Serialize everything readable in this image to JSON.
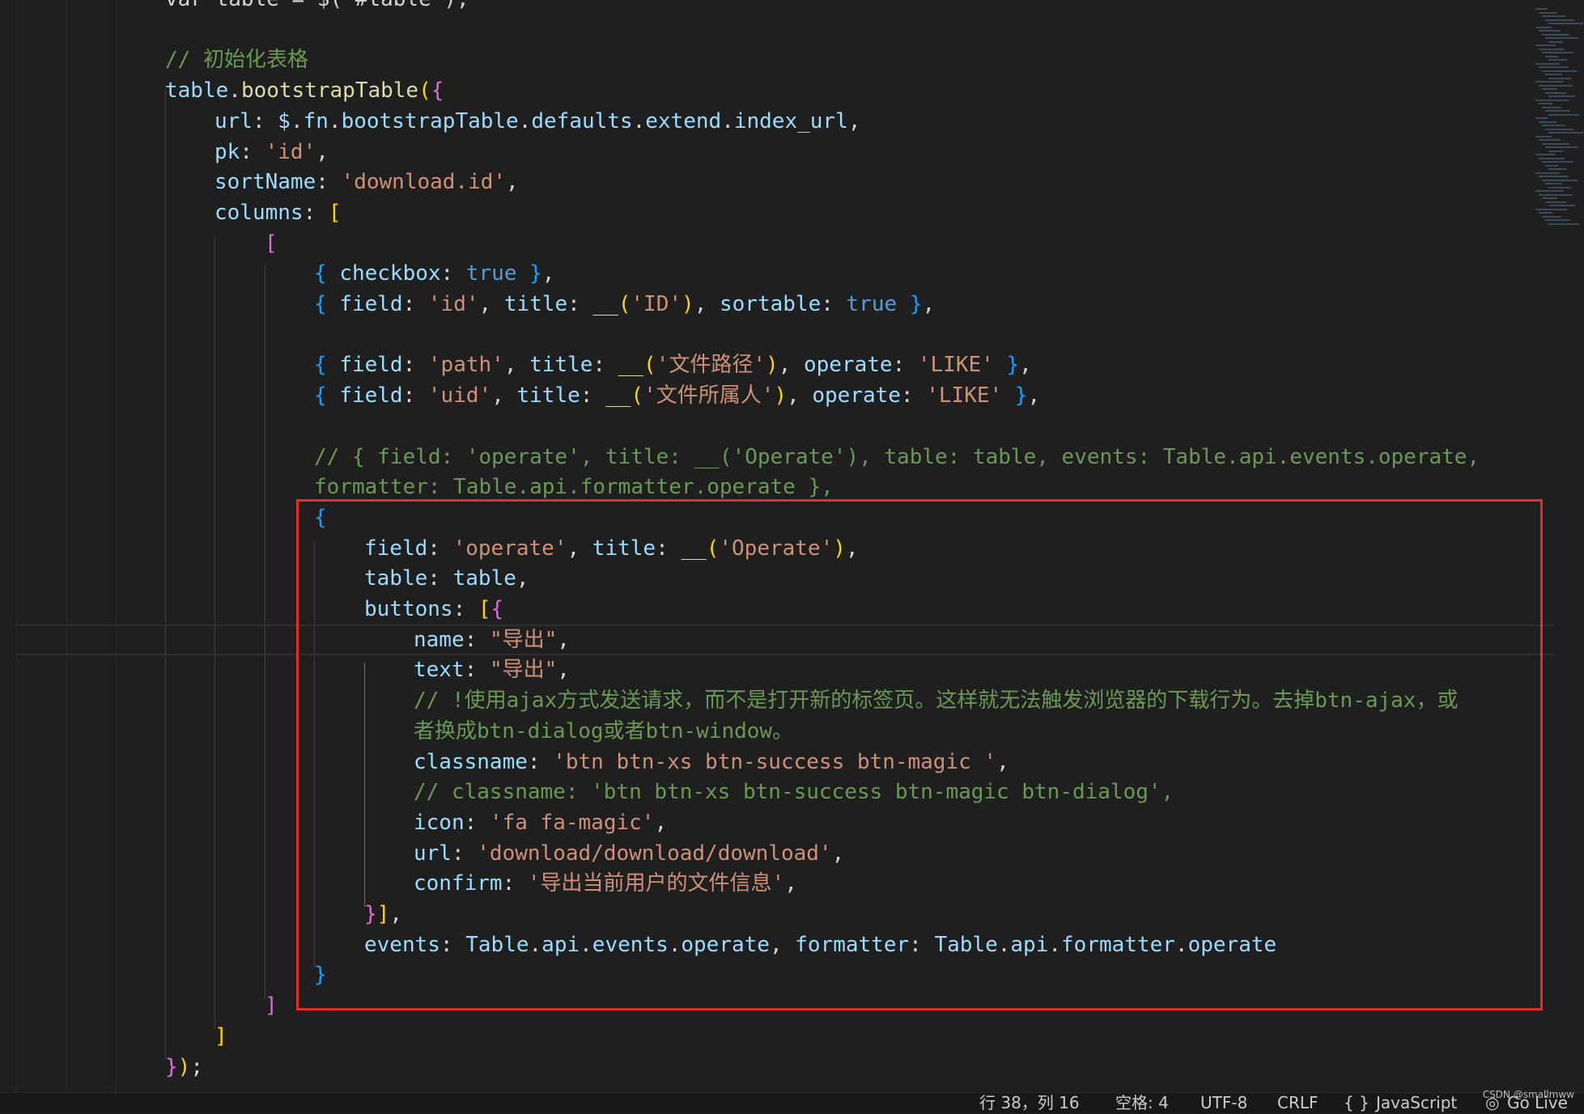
{
  "editor": {
    "lines": [
      {
        "tokens": [
          [
            "default",
            "var table = $(\"#table\");"
          ]
        ]
      },
      {
        "tokens": []
      },
      {
        "tokens": [
          [
            "comment",
            "// 初始化表格"
          ]
        ]
      },
      {
        "tokens": [
          [
            "var",
            "table"
          ],
          [
            "punc",
            "."
          ],
          [
            "fn",
            "bootstrapTable"
          ],
          [
            "brk1",
            "("
          ],
          [
            "brk2",
            "{"
          ]
        ]
      },
      {
        "tokens": [
          [
            "var",
            "url"
          ],
          [
            "punc",
            ": "
          ],
          [
            "var",
            "$"
          ],
          [
            "punc",
            "."
          ],
          [
            "var",
            "fn"
          ],
          [
            "punc",
            "."
          ],
          [
            "var",
            "bootstrapTable"
          ],
          [
            "punc",
            "."
          ],
          [
            "var",
            "defaults"
          ],
          [
            "punc",
            "."
          ],
          [
            "var",
            "extend"
          ],
          [
            "punc",
            "."
          ],
          [
            "var",
            "index_url"
          ],
          [
            "punc",
            ","
          ]
        ]
      },
      {
        "tokens": [
          [
            "var",
            "pk"
          ],
          [
            "punc",
            ": "
          ],
          [
            "str",
            "'id'"
          ],
          [
            "punc",
            ","
          ]
        ]
      },
      {
        "tokens": [
          [
            "var",
            "sortName"
          ],
          [
            "punc",
            ": "
          ],
          [
            "str",
            "'download.id'"
          ],
          [
            "punc",
            ","
          ]
        ]
      },
      {
        "tokens": [
          [
            "var",
            "columns"
          ],
          [
            "punc",
            ": "
          ],
          [
            "brk1",
            "["
          ]
        ]
      },
      {
        "tokens": [
          [
            "brk2",
            "["
          ]
        ]
      },
      {
        "tokens": [
          [
            "brk3",
            "{ "
          ],
          [
            "var",
            "checkbox"
          ],
          [
            "punc",
            ": "
          ],
          [
            "kw",
            "true"
          ],
          [
            "brk3",
            " }"
          ],
          [
            "punc",
            ","
          ]
        ]
      },
      {
        "tokens": [
          [
            "brk3",
            "{ "
          ],
          [
            "var",
            "field"
          ],
          [
            "punc",
            ": "
          ],
          [
            "str",
            "'id'"
          ],
          [
            "punc",
            ", "
          ],
          [
            "var",
            "title"
          ],
          [
            "punc",
            ": "
          ],
          [
            "fn",
            "__"
          ],
          [
            "brk1",
            "("
          ],
          [
            "str",
            "'ID'"
          ],
          [
            "brk1",
            ")"
          ],
          [
            "punc",
            ", "
          ],
          [
            "var",
            "sortable"
          ],
          [
            "punc",
            ": "
          ],
          [
            "kw",
            "true"
          ],
          [
            "brk3",
            " }"
          ],
          [
            "punc",
            ","
          ]
        ]
      },
      {
        "tokens": []
      },
      {
        "tokens": [
          [
            "brk3",
            "{ "
          ],
          [
            "var",
            "field"
          ],
          [
            "punc",
            ": "
          ],
          [
            "str",
            "'path'"
          ],
          [
            "punc",
            ", "
          ],
          [
            "var",
            "title"
          ],
          [
            "punc",
            ": "
          ],
          [
            "fn",
            "__"
          ],
          [
            "brk1",
            "("
          ],
          [
            "str",
            "'文件路径'"
          ],
          [
            "brk1",
            ")"
          ],
          [
            "punc",
            ", "
          ],
          [
            "var",
            "operate"
          ],
          [
            "punc",
            ": "
          ],
          [
            "str",
            "'LIKE'"
          ],
          [
            "brk3",
            " }"
          ],
          [
            "punc",
            ","
          ]
        ]
      },
      {
        "tokens": [
          [
            "brk3",
            "{ "
          ],
          [
            "var",
            "field"
          ],
          [
            "punc",
            ": "
          ],
          [
            "str",
            "'uid'"
          ],
          [
            "punc",
            ", "
          ],
          [
            "var",
            "title"
          ],
          [
            "punc",
            ": "
          ],
          [
            "fn",
            "__"
          ],
          [
            "brk1",
            "("
          ],
          [
            "str",
            "'文件所属人'"
          ],
          [
            "brk1",
            ")"
          ],
          [
            "punc",
            ", "
          ],
          [
            "var",
            "operate"
          ],
          [
            "punc",
            ": "
          ],
          [
            "str",
            "'LIKE'"
          ],
          [
            "brk3",
            " }"
          ],
          [
            "punc",
            ","
          ]
        ]
      },
      {
        "tokens": []
      },
      {
        "tokens": [
          [
            "comment",
            "// { field: 'operate', title: __('Operate'), table: table, events: Table.api.events.operate,"
          ]
        ]
      },
      {
        "tokens": [
          [
            "comment",
            "formatter: Table.api.formatter.operate },"
          ]
        ]
      },
      {
        "tokens": [
          [
            "brk3",
            "{"
          ]
        ]
      },
      {
        "tokens": [
          [
            "var",
            "field"
          ],
          [
            "punc",
            ": "
          ],
          [
            "str",
            "'operate'"
          ],
          [
            "punc",
            ", "
          ],
          [
            "var",
            "title"
          ],
          [
            "punc",
            ": "
          ],
          [
            "fn",
            "__"
          ],
          [
            "brk1",
            "("
          ],
          [
            "str",
            "'Operate'"
          ],
          [
            "brk1",
            ")"
          ],
          [
            "punc",
            ","
          ]
        ]
      },
      {
        "tokens": [
          [
            "var",
            "table"
          ],
          [
            "punc",
            ": "
          ],
          [
            "var",
            "table"
          ],
          [
            "punc",
            ","
          ]
        ]
      },
      {
        "tokens": [
          [
            "var",
            "buttons"
          ],
          [
            "punc",
            ": "
          ],
          [
            "brk1",
            "["
          ],
          [
            "brk2",
            "{"
          ]
        ]
      },
      {
        "tokens": [
          [
            "var",
            "name"
          ],
          [
            "punc",
            ": "
          ],
          [
            "str",
            "\"导出\""
          ],
          [
            "punc",
            ","
          ]
        ]
      },
      {
        "tokens": [
          [
            "var",
            "text"
          ],
          [
            "punc",
            ": "
          ],
          [
            "str",
            "\"导出\""
          ],
          [
            "punc",
            ","
          ]
        ]
      },
      {
        "tokens": [
          [
            "comment",
            "// !使用ajax方式发送请求，而不是打开新的标签页。这样就无法触发浏览器的下载行为。去掉btn-ajax，或"
          ]
        ]
      },
      {
        "tokens": [
          [
            "comment",
            "者换成btn-dialog或者btn-window。"
          ]
        ]
      },
      {
        "tokens": [
          [
            "var",
            "classname"
          ],
          [
            "punc",
            ": "
          ],
          [
            "str",
            "'btn btn-xs btn-success btn-magic '"
          ],
          [
            "punc",
            ","
          ]
        ]
      },
      {
        "tokens": [
          [
            "comment",
            "// classname: 'btn btn-xs btn-success btn-magic btn-dialog',"
          ]
        ]
      },
      {
        "tokens": [
          [
            "var",
            "icon"
          ],
          [
            "punc",
            ": "
          ],
          [
            "str",
            "'fa fa-magic'"
          ],
          [
            "punc",
            ","
          ]
        ]
      },
      {
        "tokens": [
          [
            "var",
            "url"
          ],
          [
            "punc",
            ": "
          ],
          [
            "str",
            "'download/download/download'"
          ],
          [
            "punc",
            ","
          ]
        ]
      },
      {
        "tokens": [
          [
            "var",
            "confirm"
          ],
          [
            "punc",
            ": "
          ],
          [
            "str",
            "'导出当前用户的文件信息'"
          ],
          [
            "punc",
            ","
          ]
        ]
      },
      {
        "tokens": [
          [
            "brk2",
            "}"
          ],
          [
            "brk1",
            "]"
          ],
          [
            "punc",
            ","
          ]
        ]
      },
      {
        "tokens": [
          [
            "var",
            "events"
          ],
          [
            "punc",
            ": "
          ],
          [
            "var",
            "Table"
          ],
          [
            "punc",
            "."
          ],
          [
            "var",
            "api"
          ],
          [
            "punc",
            "."
          ],
          [
            "var",
            "events"
          ],
          [
            "punc",
            "."
          ],
          [
            "var",
            "operate"
          ],
          [
            "punc",
            ", "
          ],
          [
            "var",
            "formatter"
          ],
          [
            "punc",
            ": "
          ],
          [
            "var",
            "Table"
          ],
          [
            "punc",
            "."
          ],
          [
            "var",
            "api"
          ],
          [
            "punc",
            "."
          ],
          [
            "var",
            "formatter"
          ],
          [
            "punc",
            "."
          ],
          [
            "var",
            "operate"
          ]
        ]
      },
      {
        "tokens": [
          [
            "brk3",
            "}"
          ]
        ]
      },
      {
        "tokens": [
          [
            "brk2",
            "]"
          ]
        ]
      },
      {
        "tokens": [
          [
            "brk1",
            "]"
          ]
        ]
      },
      {
        "tokens": [
          [
            "brk2",
            "}"
          ],
          [
            "brk1",
            ")"
          ],
          [
            "punc",
            ";"
          ]
        ]
      }
    ]
  },
  "statusbar": {
    "position": "行 38，列 16",
    "spaces": "空格: 4",
    "encoding": "UTF-8",
    "eol": "CRLF",
    "language_icon": "{ }",
    "language": "JavaScript",
    "golive": "Go Live"
  },
  "watermark": "CSDN @smallmww"
}
